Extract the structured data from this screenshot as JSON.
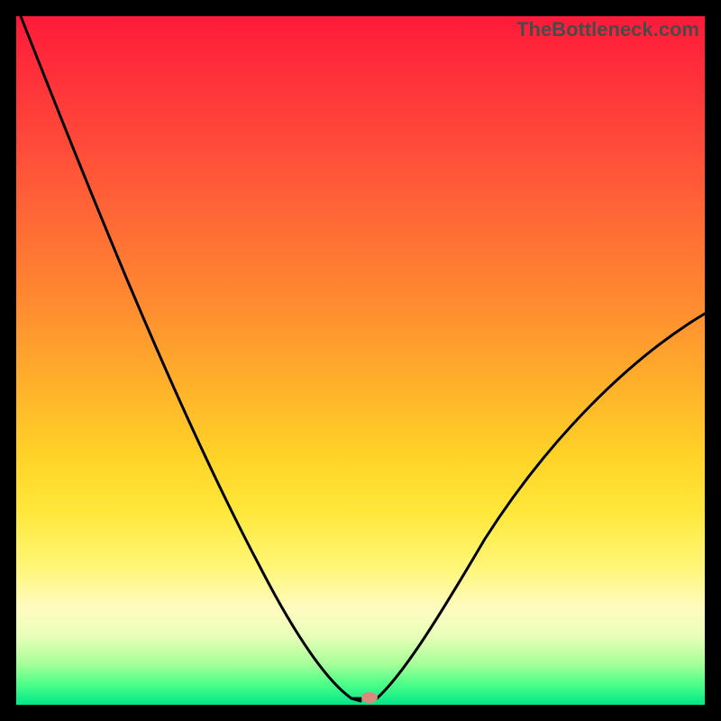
{
  "watermark": "TheBottleneck.com",
  "chart_data": {
    "type": "line",
    "title": "",
    "xlabel": "",
    "ylabel": "",
    "xlim": [
      0,
      100
    ],
    "ylim": [
      0,
      100
    ],
    "note": "V-shaped bottleneck curve on a rainbow heat gradient. X is an unlabeled index (approx. 0–100 across width); Y is an unlabeled magnitude (approx. 0 at bottom, 100 at top). Values below are read off the plotted black curve.",
    "series": [
      {
        "name": "bottleneck-curve",
        "x": [
          0,
          5,
          10,
          15,
          20,
          25,
          30,
          35,
          40,
          45,
          48,
          50,
          52,
          55,
          60,
          65,
          70,
          75,
          80,
          85,
          90,
          95,
          100
        ],
        "values": [
          100,
          90,
          80,
          70,
          60,
          50,
          41,
          32,
          23,
          13,
          6,
          2,
          1,
          4,
          10,
          17,
          24,
          30,
          36,
          42,
          47,
          52,
          56
        ]
      }
    ],
    "minimum_marker": {
      "x": 51,
      "y": 1
    },
    "gradient_stops": [
      {
        "pos": 0,
        "color": "#ff1a3a"
      },
      {
        "pos": 30,
        "color": "#ff6a35"
      },
      {
        "pos": 64,
        "color": "#ffd327"
      },
      {
        "pos": 86,
        "color": "#fffbc0"
      },
      {
        "pos": 100,
        "color": "#00e888"
      }
    ]
  }
}
